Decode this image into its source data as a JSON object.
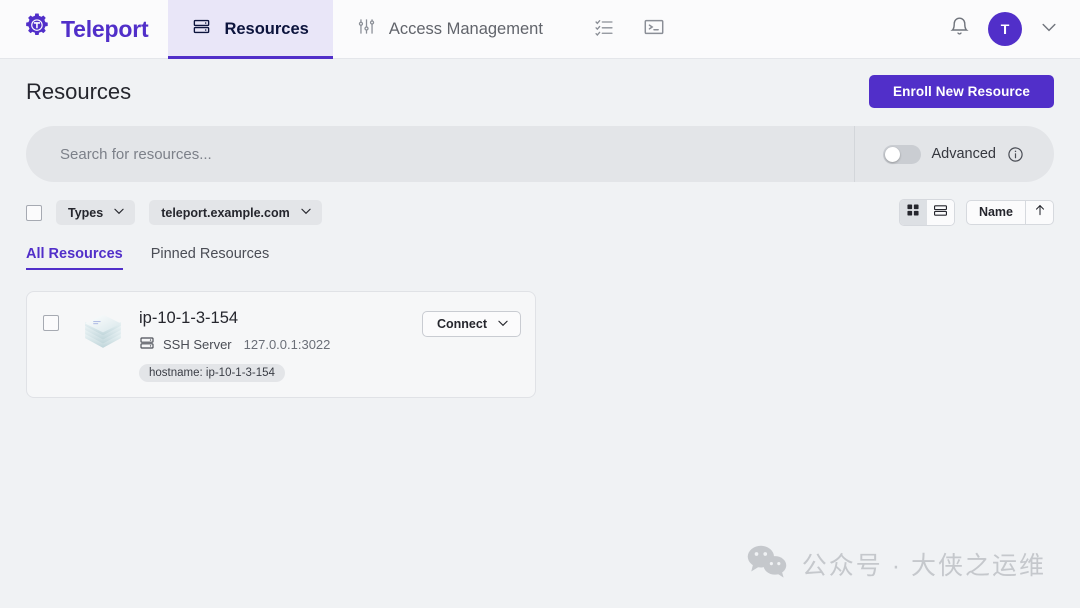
{
  "brand": {
    "name": "Teleport",
    "logo_icon": "teleport-gear-icon",
    "accent": "#512FC9"
  },
  "nav": {
    "tabs": [
      {
        "label": "Resources",
        "icon": "server-rack-icon",
        "active": true
      },
      {
        "label": "Access Management",
        "icon": "sliders-icon",
        "active": false
      }
    ],
    "icons": [
      {
        "name": "checklist-icon"
      },
      {
        "name": "terminal-icon"
      }
    ],
    "right": {
      "notifications_icon": "bell-icon",
      "avatar_initial": "T",
      "menu_icon": "chevron-down-icon"
    }
  },
  "page": {
    "title": "Resources",
    "enroll_button": "Enroll New Resource"
  },
  "search": {
    "placeholder": "Search for resources...",
    "value": "",
    "advanced_label": "Advanced",
    "advanced_enabled": false,
    "info_icon": "info-circle-icon"
  },
  "filters": {
    "select_all_checked": false,
    "types_label": "Types",
    "cluster_label": "teleport.example.com",
    "view_mode": "grid",
    "views": [
      {
        "name": "grid-view",
        "active": true
      },
      {
        "name": "list-view",
        "active": false
      }
    ],
    "sort_label": "Name",
    "sort_direction_icon": "arrow-up-icon"
  },
  "subtabs": [
    {
      "label": "All Resources",
      "active": true
    },
    {
      "label": "Pinned Resources",
      "active": false
    }
  ],
  "resources": [
    {
      "name": "ip-10-1-3-154",
      "kind": "SSH Server",
      "address": "127.0.0.1:3022",
      "labels": [
        "hostname: ip-10-1-3-154"
      ],
      "action_label": "Connect",
      "icon": "server-stack-icon",
      "checked": false
    }
  ],
  "watermark": {
    "text": "公众号 · 大侠之运维",
    "icon": "wechat-icon"
  }
}
